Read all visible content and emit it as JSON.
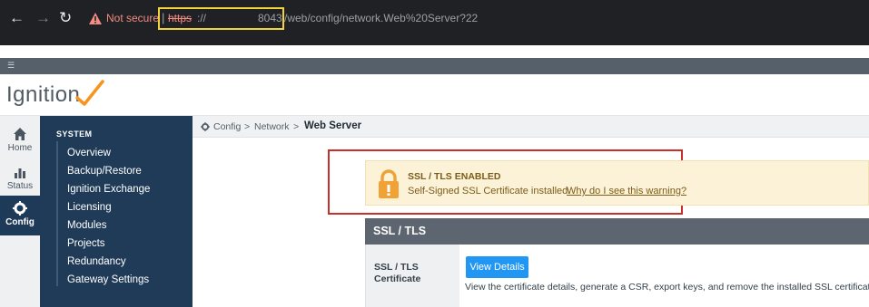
{
  "browser": {
    "back_icon": "arrow-left-icon",
    "forward_icon": "arrow-right-icon",
    "reload_icon": "reload-icon",
    "not_secure": "Not secure",
    "separator": "|",
    "scheme": "https",
    "scheme_tail": "://",
    "port": "8043",
    "path": "/web/config/network.Web%20Server?22",
    "highlight_color": "#f2d33b"
  },
  "logo": {
    "text": "Ignition",
    "check_color": "#f7941d"
  },
  "rail": {
    "items": [
      {
        "label": "Home",
        "icon": "home-icon"
      },
      {
        "label": "Status",
        "icon": "bar-chart-icon"
      },
      {
        "label": "Config",
        "icon": "gear-icon"
      }
    ]
  },
  "sidebar": {
    "section": "SYSTEM",
    "items": [
      "Overview",
      "Backup/Restore",
      "Ignition Exchange",
      "Licensing",
      "Modules",
      "Projects",
      "Redundancy",
      "Gateway Settings"
    ]
  },
  "breadcrumb": {
    "root": "Config",
    "mid": "Network",
    "current": "Web Server",
    "sep": ">"
  },
  "alert": {
    "title": "SSL / TLS ENABLED",
    "message": "Self-Signed SSL Certificate  installed.",
    "link": "Why do I see this warning?",
    "icon": "lock-icon",
    "outline_color": "#c9302c"
  },
  "ssl": {
    "heading": "SSL / TLS",
    "label_line1": "SSL / TLS",
    "label_line2": "Certificate",
    "button": "View Details",
    "description": "View the certificate details, generate a CSR, export keys, and remove the installed SSL certificate"
  }
}
